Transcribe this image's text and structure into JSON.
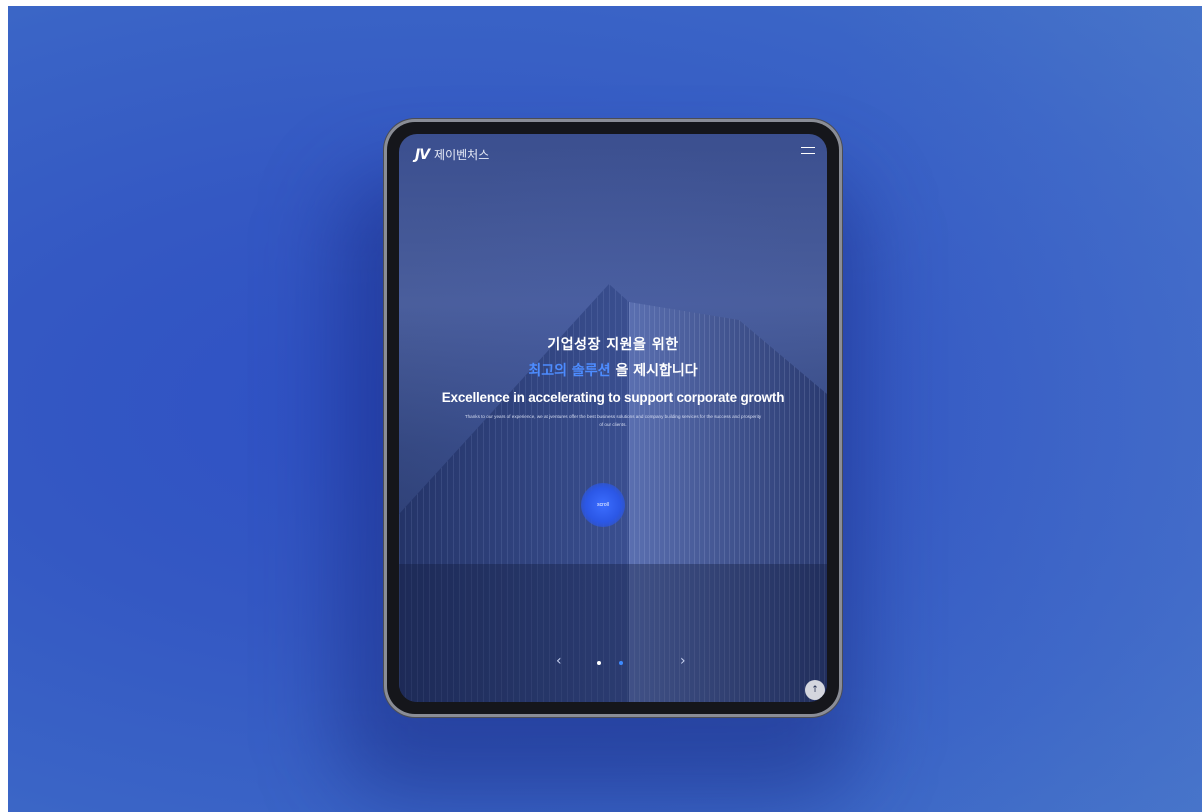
{
  "header": {
    "logo_mark": "JV",
    "logo_text": "제이벤처스",
    "menu_icon": "hamburger-icon"
  },
  "hero": {
    "line1": "기업성장 지원을 위한",
    "line2_accent": "최고의 솔루션",
    "line2_rest": "을 제시합니다",
    "title_en": "Excellence in accelerating to support corporate growth",
    "description": "Thanks to our years of experience, we at jventures offer the best business solutions and company building services for the success and prosperity of our clients."
  },
  "scroll_button": {
    "label": "scroll"
  },
  "slider": {
    "prev_icon": "chevron-left-icon",
    "next_icon": "chevron-right-icon",
    "prev_glyph": "‹",
    "next_glyph": "›",
    "dots": 2,
    "active_dot": 2
  },
  "top_button": {
    "icon": "arrow-up-icon",
    "glyph": "↑"
  },
  "colors": {
    "background": "#3458c3",
    "accent": "#4d8cff",
    "scroll_button": "#2b57e6"
  }
}
